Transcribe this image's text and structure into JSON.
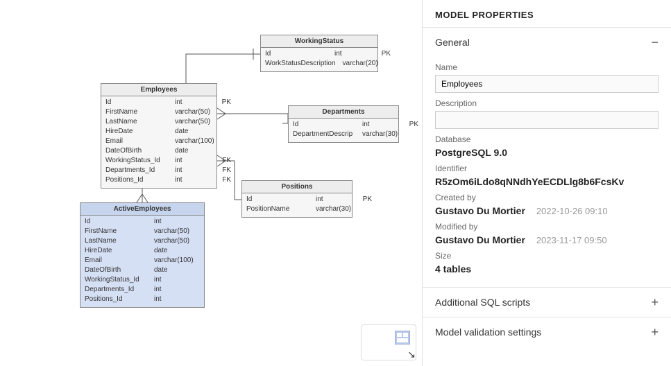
{
  "sidebar_title": "MODEL PROPERTIES",
  "sections": {
    "general": {
      "heading": "General",
      "name_label": "Name",
      "name_value": "Employees",
      "description_label": "Description",
      "description_value": "",
      "database_label": "Database",
      "database_value": "PostgreSQL 9.0",
      "identifier_label": "Identifier",
      "identifier_value": "R5zOm6iLdo8qNNdhYeECDLlg8b6FcsKv",
      "created_label": "Created by",
      "created_by": "Gustavo Du Mortier",
      "created_at": "2022-10-26 09:10",
      "modified_label": "Modified by",
      "modified_by": "Gustavo Du Mortier",
      "modified_at": "2023-11-17 09:50",
      "size_label": "Size",
      "size_value": "4 tables"
    },
    "additional_sql": {
      "heading": "Additional SQL scripts"
    },
    "validation": {
      "heading": "Model validation settings"
    }
  },
  "tables": {
    "working_status": {
      "title": "WorkingStatus",
      "cols": [
        {
          "name": "Id",
          "type": "int",
          "key": "PK"
        },
        {
          "name": "WorkStatusDescription",
          "type": "varchar(20)",
          "key": ""
        }
      ]
    },
    "employees": {
      "title": "Employees",
      "cols": [
        {
          "name": "Id",
          "type": "int",
          "key": "PK"
        },
        {
          "name": "FirstName",
          "type": "varchar(50)",
          "key": ""
        },
        {
          "name": "LastName",
          "type": "varchar(50)",
          "key": ""
        },
        {
          "name": "HireDate",
          "type": "date",
          "key": ""
        },
        {
          "name": "Email",
          "type": "varchar(100)",
          "key": ""
        },
        {
          "name": "DateOfBirth",
          "type": "date",
          "key": ""
        },
        {
          "name": "WorkingStatus_Id",
          "type": "int",
          "key": "FK"
        },
        {
          "name": "Departments_Id",
          "type": "int",
          "key": "FK"
        },
        {
          "name": "Positions_Id",
          "type": "int",
          "key": "FK"
        }
      ]
    },
    "departments": {
      "title": "Departments",
      "cols": [
        {
          "name": "Id",
          "type": "int",
          "key": "PK"
        },
        {
          "name": "DepartmentDescrip",
          "type": "varchar(30)",
          "key": ""
        }
      ]
    },
    "positions": {
      "title": "Positions",
      "cols": [
        {
          "name": "Id",
          "type": "int",
          "key": "PK"
        },
        {
          "name": "PositionName",
          "type": "varchar(30)",
          "key": ""
        }
      ]
    },
    "active_employees": {
      "title": "ActiveEmployees",
      "cols": [
        {
          "name": "Id",
          "type": "int",
          "key": ""
        },
        {
          "name": "FirstName",
          "type": "varchar(50)",
          "key": ""
        },
        {
          "name": "LastName",
          "type": "varchar(50)",
          "key": ""
        },
        {
          "name": "HireDate",
          "type": "date",
          "key": ""
        },
        {
          "name": "Email",
          "type": "varchar(100)",
          "key": ""
        },
        {
          "name": "DateOfBirth",
          "type": "date",
          "key": ""
        },
        {
          "name": "WorkingStatus_Id",
          "type": "int",
          "key": ""
        },
        {
          "name": "Departments_Id",
          "type": "int",
          "key": ""
        },
        {
          "name": "Positions_Id",
          "type": "int",
          "key": ""
        }
      ]
    }
  }
}
